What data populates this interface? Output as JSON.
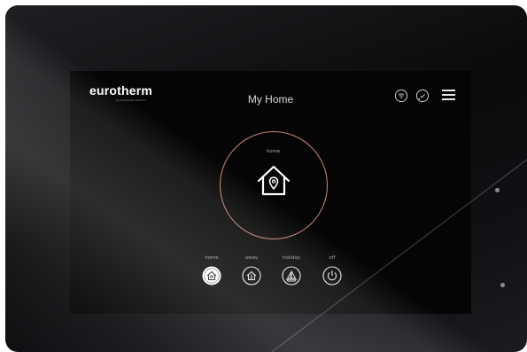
{
  "brand": {
    "name": "eurotherm",
    "tagline": "by Schneider Electric"
  },
  "header": {
    "title": "My Home",
    "icons": [
      "wifi-signal-icon",
      "notification-check-icon",
      "hamburger-menu-icon"
    ]
  },
  "current_mode": {
    "label": "home",
    "icon": "house-location-icon",
    "ring_color": "#c98670"
  },
  "modes": [
    {
      "label": "home",
      "icon": "house-icon",
      "selected": true
    },
    {
      "label": "away",
      "icon": "house-walking-person-icon",
      "selected": false
    },
    {
      "label": "holiday",
      "icon": "sailboat-icon",
      "selected": false
    },
    {
      "label": "off",
      "icon": "power-icon",
      "selected": false
    }
  ]
}
